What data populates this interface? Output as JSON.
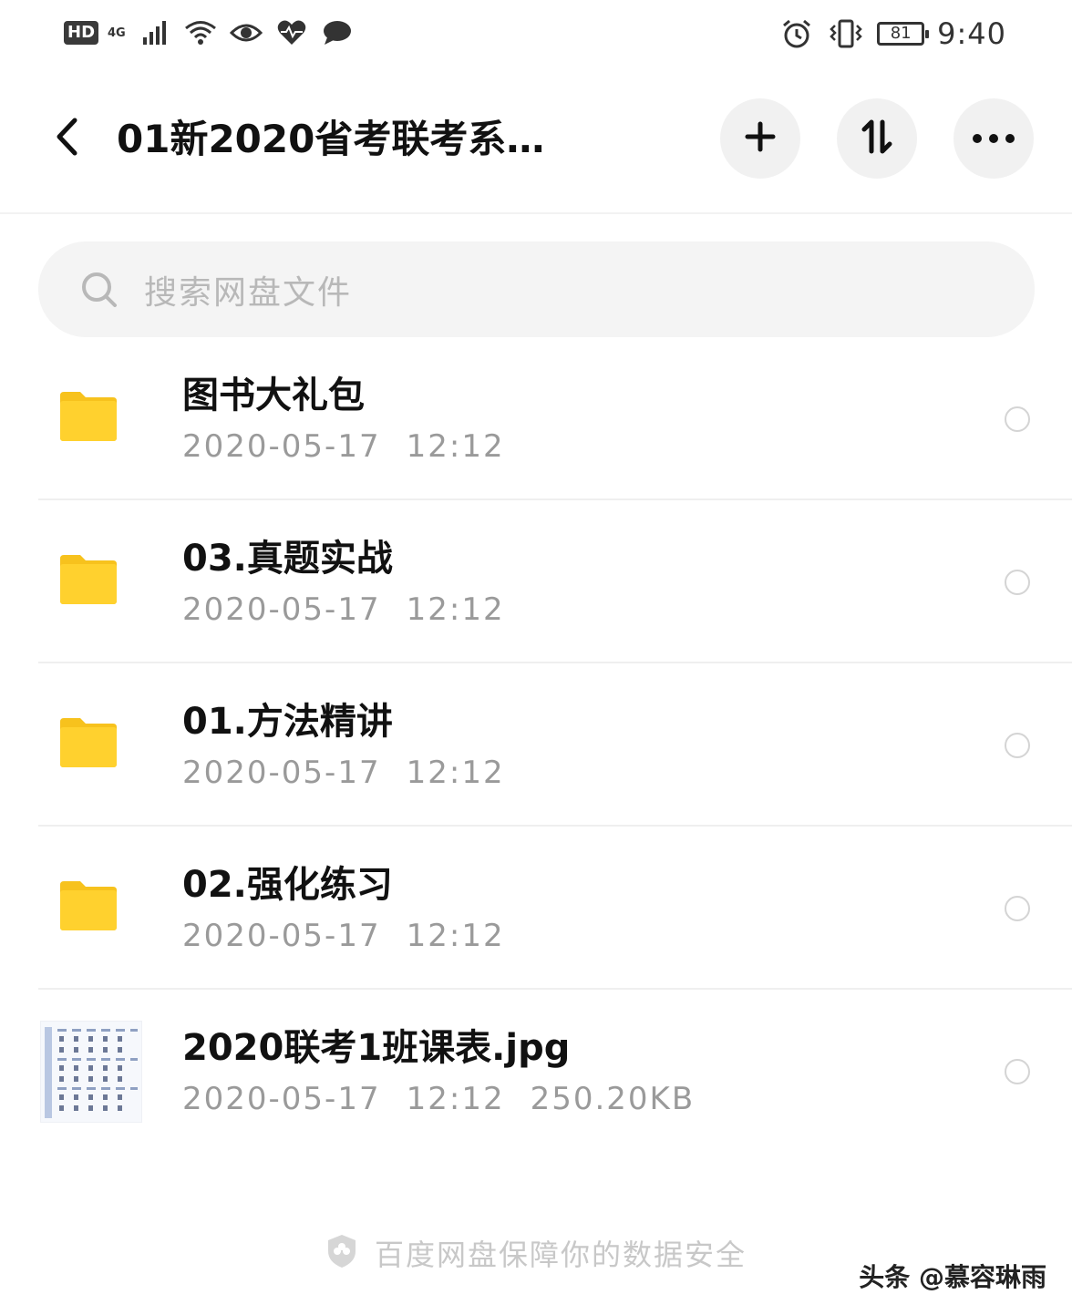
{
  "status_bar": {
    "hd_label": "HD",
    "network_label": "4G",
    "battery_level": "81",
    "time": "9:40",
    "icons": [
      "signal-icon",
      "wifi-icon",
      "eye-icon",
      "heart-pulse-icon",
      "chat-bubble-icon",
      "alarm-icon",
      "vibrate-icon",
      "battery-icon"
    ]
  },
  "header": {
    "title": "01新2020省考联考系…",
    "back_icon": "chevron-left-icon",
    "add_icon": "plus-icon",
    "sort_icon": "sort-icon",
    "more_icon": "more-horizontal-icon"
  },
  "search": {
    "placeholder": "搜索网盘文件"
  },
  "files": [
    {
      "name": "图书大礼包",
      "date": "2020-05-17",
      "time": "12:12",
      "size": "",
      "type": "folder"
    },
    {
      "name": "03.真题实战",
      "date": "2020-05-17",
      "time": "12:12",
      "size": "",
      "type": "folder"
    },
    {
      "name": "01.方法精讲",
      "date": "2020-05-17",
      "time": "12:12",
      "size": "",
      "type": "folder"
    },
    {
      "name": "02.强化练习",
      "date": "2020-05-17",
      "time": "12:12",
      "size": "",
      "type": "folder"
    },
    {
      "name": "2020联考1班课表.jpg",
      "date": "2020-05-17",
      "time": "12:12",
      "size": "250.20KB",
      "type": "image"
    }
  ],
  "footer": {
    "note": "百度网盘保障你的数据安全"
  },
  "watermark": "头条 @慕容琳雨",
  "colors": {
    "folder": "#FFD12E",
    "folder_tab": "#F7C21D",
    "button_bg": "#F1F1F1",
    "search_bg": "#F4F4F4",
    "meta_text": "#9A9A9A"
  }
}
